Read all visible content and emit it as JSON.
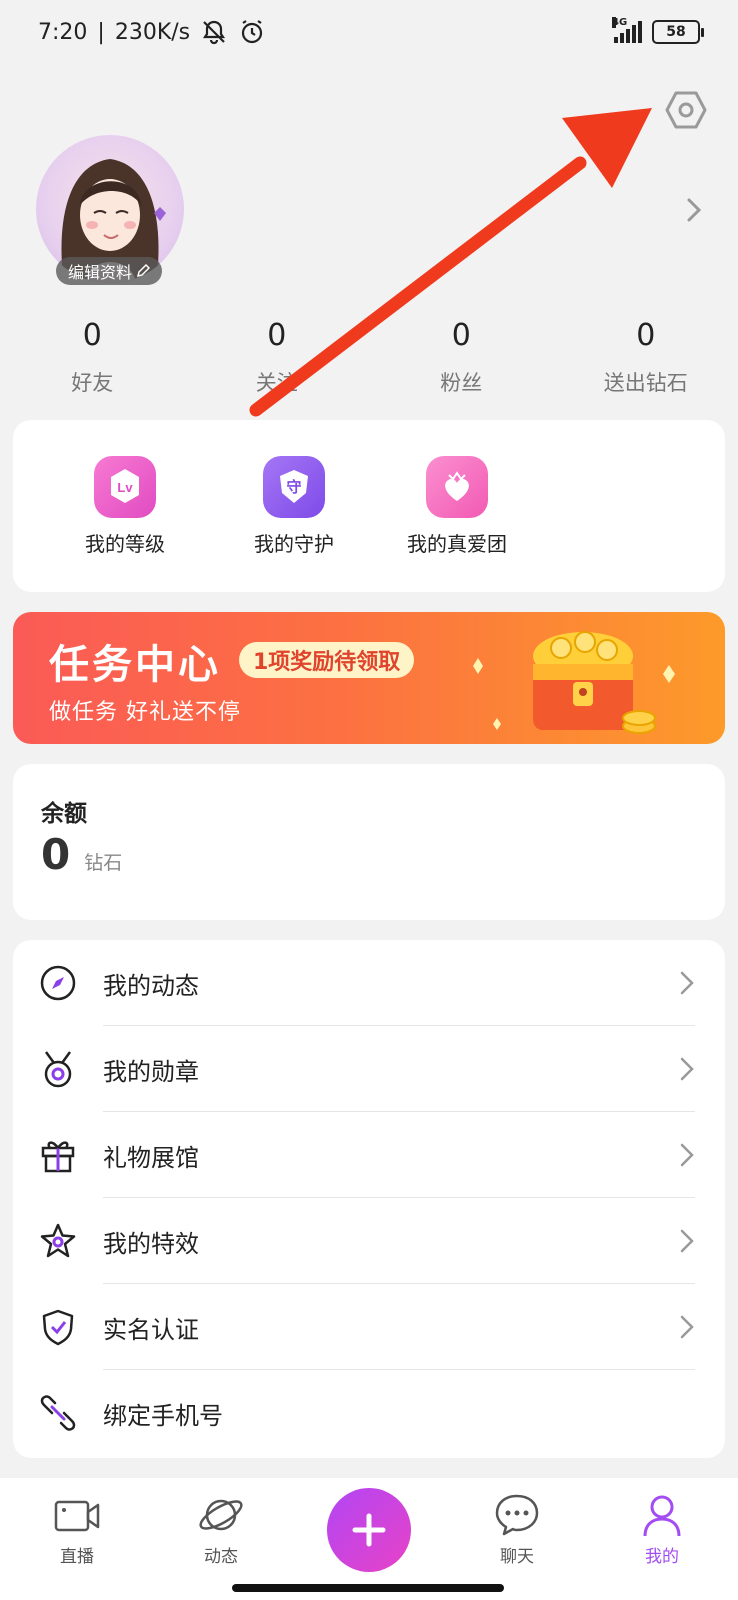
{
  "status_bar": {
    "time": "7:20",
    "separator": "|",
    "speed": "230K/s",
    "network": "4G",
    "battery": "58"
  },
  "profile": {
    "edit_label": "编辑资料",
    "edit_icon": "pencil-icon"
  },
  "stats": [
    {
      "value": "0",
      "label": "好友"
    },
    {
      "value": "0",
      "label": "关注"
    },
    {
      "value": "0",
      "label": "粉丝"
    },
    {
      "value": "0",
      "label": "送出钻石"
    }
  ],
  "quick_actions": [
    {
      "label": "我的等级",
      "icon": "level-badge-icon",
      "badge_text": "Lv"
    },
    {
      "label": "我的守护",
      "icon": "guard-shield-icon",
      "badge_text": "守"
    },
    {
      "label": "我的真爱团",
      "icon": "heart-crown-icon"
    }
  ],
  "task_banner": {
    "title": "任务中心",
    "badge": "1项奖励待领取",
    "subtitle": "做任务 好礼送不停"
  },
  "balance": {
    "label": "余额",
    "value": "0",
    "unit": "钻石"
  },
  "menu": [
    {
      "label": "我的动态",
      "icon": "compass-icon"
    },
    {
      "label": "我的勋章",
      "icon": "medal-icon"
    },
    {
      "label": "礼物展馆",
      "icon": "gift-icon"
    },
    {
      "label": "我的特效",
      "icon": "star-icon"
    },
    {
      "label": "实名认证",
      "icon": "shield-check-icon"
    },
    {
      "label": "绑定手机号",
      "icon": "link-icon"
    }
  ],
  "bottom_nav": [
    {
      "label": "直播",
      "icon": "video-camera-icon"
    },
    {
      "label": "动态",
      "icon": "planet-icon"
    },
    {
      "label": "聊天",
      "icon": "chat-bubble-icon"
    },
    {
      "label": "我的",
      "icon": "person-icon",
      "active": true
    }
  ],
  "colors": {
    "accent": "#a24cf2",
    "banner_start": "#fb5a56",
    "banner_end": "#fd9a2a",
    "arrow": "#f03a1e"
  }
}
